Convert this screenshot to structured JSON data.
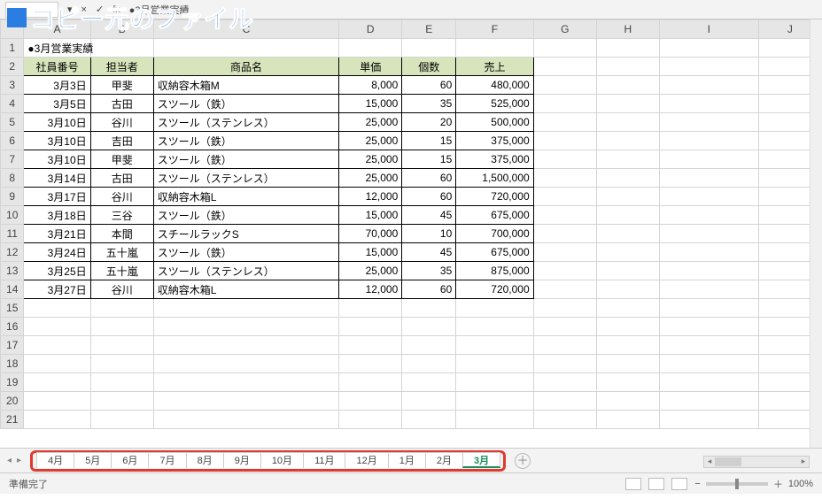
{
  "banner": "コピー元のファイル",
  "formula_bar": {
    "namebox": "",
    "fx": "fx",
    "formula": "●3月営業実績"
  },
  "columns": [
    "A",
    "B",
    "C",
    "D",
    "E",
    "F",
    "G",
    "H",
    "I",
    "J"
  ],
  "row_numbers": [
    1,
    2,
    3,
    4,
    5,
    6,
    7,
    8,
    9,
    10,
    11,
    12,
    13,
    14,
    15,
    16,
    17,
    18,
    19,
    20,
    21
  ],
  "title": "●3月営業実績",
  "headers": {
    "emp_no": "社員番号",
    "rep": "担当者",
    "product": "商品名",
    "price": "単価",
    "qty": "個数",
    "sales": "売上"
  },
  "rows": [
    {
      "date": "3月3日",
      "rep": "甲斐",
      "product": "収納容木箱M",
      "price": "8,000",
      "qty": "60",
      "sales": "480,000"
    },
    {
      "date": "3月5日",
      "rep": "古田",
      "product": "スツール（鉄）",
      "price": "15,000",
      "qty": "35",
      "sales": "525,000"
    },
    {
      "date": "3月10日",
      "rep": "谷川",
      "product": "スツール（ステンレス）",
      "price": "25,000",
      "qty": "20",
      "sales": "500,000"
    },
    {
      "date": "3月10日",
      "rep": "吉田",
      "product": "スツール（鉄）",
      "price": "25,000",
      "qty": "15",
      "sales": "375,000"
    },
    {
      "date": "3月10日",
      "rep": "甲斐",
      "product": "スツール（鉄）",
      "price": "25,000",
      "qty": "15",
      "sales": "375,000"
    },
    {
      "date": "3月14日",
      "rep": "古田",
      "product": "スツール（ステンレス）",
      "price": "25,000",
      "qty": "60",
      "sales": "1,500,000"
    },
    {
      "date": "3月17日",
      "rep": "谷川",
      "product": "収納容木箱L",
      "price": "12,000",
      "qty": "60",
      "sales": "720,000"
    },
    {
      "date": "3月18日",
      "rep": "三谷",
      "product": "スツール（鉄）",
      "price": "15,000",
      "qty": "45",
      "sales": "675,000"
    },
    {
      "date": "3月21日",
      "rep": "本間",
      "product": "スチールラックS",
      "price": "70,000",
      "qty": "10",
      "sales": "700,000"
    },
    {
      "date": "3月24日",
      "rep": "五十嵐",
      "product": "スツール（鉄）",
      "price": "15,000",
      "qty": "45",
      "sales": "675,000"
    },
    {
      "date": "3月25日",
      "rep": "五十嵐",
      "product": "スツール（ステンレス）",
      "price": "25,000",
      "qty": "35",
      "sales": "875,000"
    },
    {
      "date": "3月27日",
      "rep": "谷川",
      "product": "収納容木箱L",
      "price": "12,000",
      "qty": "60",
      "sales": "720,000"
    }
  ],
  "tabs": {
    "items": [
      "4月",
      "5月",
      "6月",
      "7月",
      "8月",
      "9月",
      "10月",
      "11月",
      "12月",
      "1月",
      "2月",
      "3月"
    ],
    "active": "3月",
    "add": "＋"
  },
  "status": {
    "ready": "準備完了",
    "zoom": "100%"
  }
}
